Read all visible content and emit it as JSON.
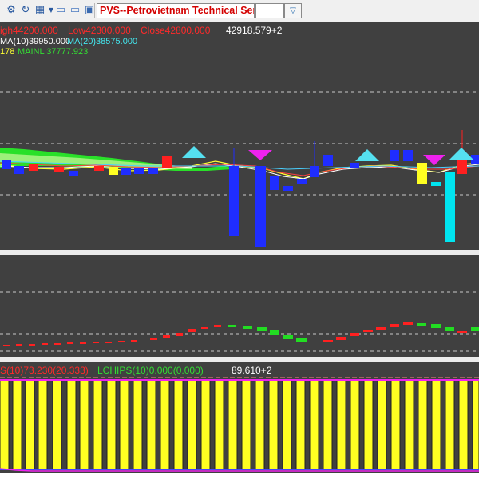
{
  "toolbar": {
    "stock_name": "PVS--Petrovietnam Technical Servic",
    "secondary_value": "",
    "icons": [
      "gear-icon",
      "refresh-icon",
      "cart-icon",
      "folder-icon",
      "folder-open-icon",
      "save-icon",
      "chevron-down-icon"
    ]
  },
  "price_panel": {
    "high": "igh44200.000",
    "low": "Low42300.000",
    "close": "Close42800.000",
    "value": "42918.579+2",
    "ma10": "MA(10)39950.000",
    "ma20": "MA(20)38575.000",
    "prefix_yellow": "178",
    "mainl": "MAINL 37777.923"
  },
  "volume_panel": {},
  "indicator_panel": {
    "label_red": "S(10)73.230(20.333)",
    "lchips": "LCHIPS(10)0.000(0.000)",
    "value": "89.610+2"
  },
  "colors": {
    "background": "#404040",
    "up": "#ff2020",
    "down": "#1f2dff",
    "green": "#22dd22",
    "cyan": "#00e5f0",
    "magenta": "#ee22ee",
    "yellow": "#ffff22",
    "indicator_bar": "#ffff22"
  }
}
